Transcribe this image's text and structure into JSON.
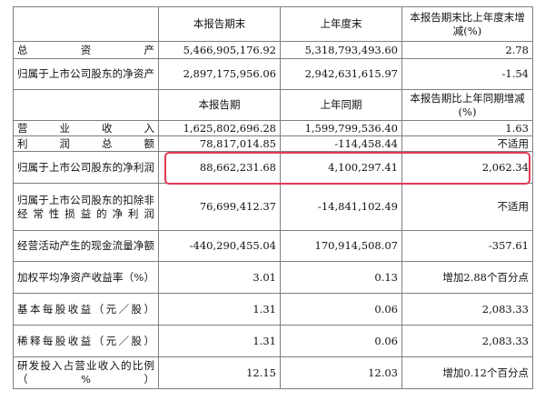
{
  "headers1": {
    "c0": "",
    "c1": "本报告期末",
    "c2": "上年度末",
    "c3": "本报告期末比上年度末增减(%)"
  },
  "headers2": {
    "c0": "",
    "c1": "本报告期",
    "c2": "上年同期",
    "c3": "本报告期比上年同期增减(%)"
  },
  "rows_a": [
    {
      "label": "总资产",
      "v1": "5,466,905,176.92",
      "v2": "5,318,793,493.60",
      "v3": "2.78"
    },
    {
      "label": "归属于上市公司股东的净资产",
      "v1": "2,897,175,956.06",
      "v2": "2,942,631,615.97",
      "v3": "-1.54"
    }
  ],
  "rows_b": [
    {
      "label": "营业收入",
      "v1": "1,625,802,696.28",
      "v2": "1,599,799,536.40",
      "v3": "1.63"
    },
    {
      "label": "利润总额",
      "v1": "78,817,014.85",
      "v2": "-114,458.44",
      "v3": "不适用"
    },
    {
      "label": "归属于上市公司股东的净利润",
      "v1": "88,662,231.68",
      "v2": "4,100,297.41",
      "v3": "2,062.34"
    },
    {
      "label": "归属于上市公司股东的扣除非经常性损益的净利润",
      "v1": "76,699,412.37",
      "v2": "-14,841,102.49",
      "v3": "不适用"
    },
    {
      "label": "经营活动产生的现金流量净额",
      "v1": "-440,290,455.04",
      "v2": "170,914,508.07",
      "v3": "-357.61"
    },
    {
      "label": "加权平均净资产收益率（%）",
      "v1": "3.01",
      "v2": "0.13",
      "v3": "增加2.88个百分点"
    },
    {
      "label": "基本每股收益（元／股）",
      "v1": "1.31",
      "v2": "0.06",
      "v3": "2,083.33"
    },
    {
      "label": "稀释每股收益（元／股）",
      "v1": "1.31",
      "v2": "0.06",
      "v3": "2,083.33"
    },
    {
      "label": "研发投入占营业收入的比例（%）",
      "v1": "12.15",
      "v2": "12.03",
      "v3": "增加0.12个百分点"
    }
  ],
  "colors": {
    "border": "#7f7f7f",
    "highlight": "#e23a56"
  }
}
